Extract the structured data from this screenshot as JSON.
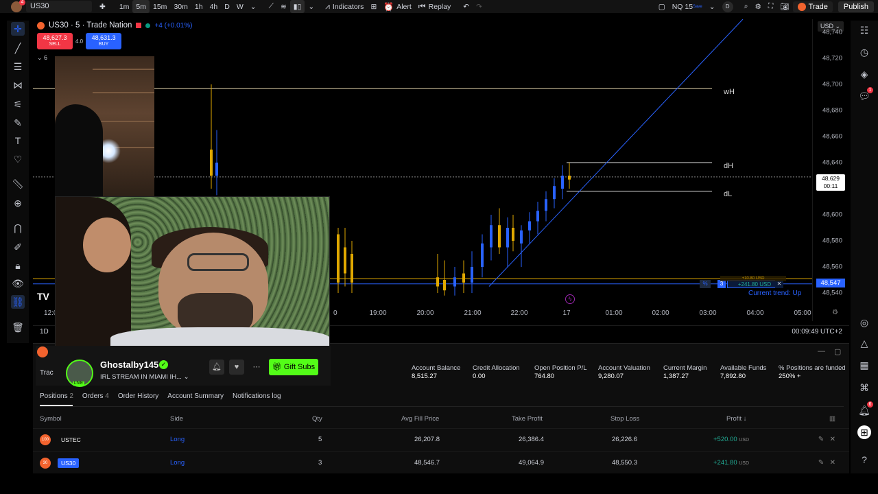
{
  "topbar": {
    "avatar_badge": "4",
    "symbol": "US30",
    "intervals": [
      "1m",
      "5m",
      "15m",
      "30m",
      "1h",
      "4h",
      "D",
      "W"
    ],
    "active_interval": "5m",
    "indicators_label": "Indicators",
    "alert_label": "Alert",
    "replay_label": "Replay",
    "nq_label": "NQ 15",
    "nq_sub": "Save",
    "d_badge": "D",
    "trade_label": "Trade",
    "publish_label": "Publish"
  },
  "chart": {
    "title": "US30 · 5 · Trade Nation",
    "change": "+4 (+0.01%)",
    "sell_price": "48,627.3",
    "sell_label": "SELL",
    "spread": "4.0",
    "buy_price": "48,631.3",
    "buy_label": "BUY",
    "currency": "USD",
    "collapse_count": "6",
    "levels": [
      "wH",
      "dH",
      "dL"
    ],
    "current_trend": "Current trend: Up",
    "last_price": "48,547",
    "cursor_price": "48,629",
    "cursor_time": "00:11",
    "position_qty": "3",
    "position_pl": "+241.80 USD",
    "position_pl_2": "+10.80 USD",
    "timeframe": "1D",
    "clock": "00:09:49 UTC+2",
    "tv_logo": "TV",
    "left_time_fragment": "12:0",
    "left_time_fragment_2": "0",
    "price_ticks": [
      "48,740",
      "48,720",
      "48,700",
      "48,680",
      "48,660",
      "48,640",
      "48,600",
      "48,580",
      "48,560",
      "48,540"
    ],
    "time_ticks": [
      "19:00",
      "20:00",
      "21:00",
      "22:00",
      "17",
      "01:00",
      "02:00",
      "03:00",
      "04:00",
      "05:00"
    ]
  },
  "chart_data": {
    "type": "line",
    "title": "US30 · 5 · Trade Nation",
    "xlabel": "",
    "ylabel": "",
    "ylim": [
      48530,
      48750
    ],
    "x": [
      "19:00",
      "20:00",
      "21:00",
      "22:00",
      "17",
      "01:00",
      "02:00",
      "03:00",
      "04:00",
      "05:00"
    ],
    "horizontal_levels": [
      {
        "name": "wH",
        "value": 48697
      },
      {
        "name": "dH",
        "value": 48640
      },
      {
        "name": "dL",
        "value": 48618
      }
    ],
    "last_price": 48547
  },
  "streamer": {
    "name": "Ghostalby145",
    "title": "IRL STREAM IN MIAMI IH...",
    "live": "LIVE",
    "gift_label": "Gift Subs",
    "trad_fragment": "Trac"
  },
  "account": {
    "fields": [
      {
        "label": "Account Balance",
        "value": "8,515.27"
      },
      {
        "label": "Credit Allocation",
        "value": "0.00"
      },
      {
        "label": "Open Position P/L",
        "value": "764.80"
      },
      {
        "label": "Account Valuation",
        "value": "9,280.07"
      },
      {
        "label": "Current Margin",
        "value": "1,387.27"
      },
      {
        "label": "Available Funds",
        "value": "7,892.80"
      },
      {
        "label": "% Positions are funded",
        "value": "250% +"
      }
    ],
    "tabs": [
      {
        "label": "Positions",
        "count": "2"
      },
      {
        "label": "Orders",
        "count": "4"
      },
      {
        "label": "Order History",
        "count": ""
      },
      {
        "label": "Account Summary",
        "count": ""
      },
      {
        "label": "Notifications log",
        "count": ""
      }
    ],
    "columns": [
      "Symbol",
      "Side",
      "Qty",
      "Avg Fill Price",
      "Take Profit",
      "Stop Loss",
      "Profit ↓"
    ],
    "rows": [
      {
        "icon": "100",
        "symbol": "USTEC",
        "side": "Long",
        "qty": "5",
        "avg": "26,207.8",
        "tp": "26,386.4",
        "sl": "26,226.6",
        "profit": "+520.00",
        "unit": "USD",
        "tag_color": "#2a2a2a"
      },
      {
        "icon": "30",
        "symbol": "US30",
        "side": "Long",
        "qty": "3",
        "avg": "48,546.7",
        "tp": "49,064.9",
        "sl": "48,550.3",
        "profit": "+241.80",
        "unit": "USD",
        "tag_color": "#2962ff"
      }
    ]
  },
  "rightbar": {
    "chat_badge": "1",
    "bell_badge": "6"
  }
}
